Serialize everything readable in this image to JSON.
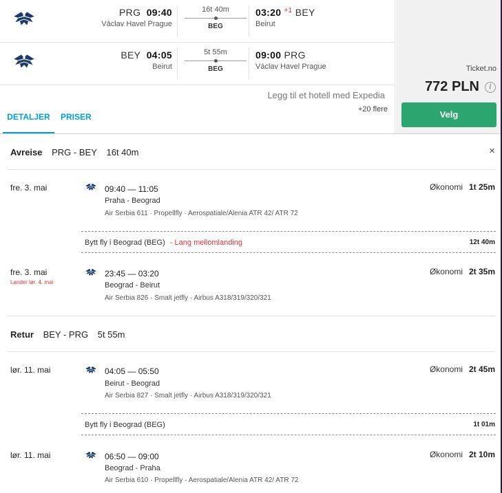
{
  "summary": {
    "outbound": {
      "dep_code": "PRG",
      "dep_time": "09:40",
      "dep_airport": "Václav Havel Prague",
      "duration": "16t 40m",
      "stop": "BEG",
      "arr_time": "03:20",
      "arr_plus": "+1",
      "arr_code": "BEY",
      "arr_airport": "Beirut"
    },
    "return": {
      "dep_code": "BEY",
      "dep_time": "04:05",
      "dep_airport": "Beirut",
      "duration": "5t 55m",
      "stop": "BEG",
      "arr_time": "09:00",
      "arr_code": "PRG",
      "arr_airport": "Václav Havel Prague"
    },
    "hotel_link": "Legg til et hotell med Expedia",
    "tabs": [
      "DETALJER",
      "PRISER"
    ],
    "more_providers": "+20 flere",
    "provider": "Ticket.no",
    "price": "772 PLN",
    "info_icon": "i",
    "select_label": "Velg"
  },
  "details": {
    "close_icon": "×",
    "outbound": {
      "label": "Avreise",
      "route": "PRG - BEY",
      "duration": "16t 40m",
      "segments": [
        {
          "date": "fre. 3. mai",
          "sub": "",
          "times": "09:40 — 11:05",
          "cities": "Praha - Beograd",
          "info": "Air Serbia 611 · Propellfly · Aerospatiale/Alenia ATR 42/ ATR 72",
          "cabin": "Økonomi",
          "duration": "1t 25m"
        },
        {
          "date": "fre. 3. mai",
          "sub": "Lander lør. 4. mai",
          "times": "23:45 — 03:20",
          "cities": "Beograd - Beirut",
          "info": "Air Serbia 826 · Smalt jetfly · Airbus A318/319/320/321",
          "cabin": "Økonomi",
          "duration": "2t 35m"
        }
      ],
      "layover": {
        "text": "Bytt fly i Beograd (BEG)",
        "warning": "- Lang mellomlanding",
        "duration": "12t 40m"
      }
    },
    "return": {
      "label": "Retur",
      "route": "BEY - PRG",
      "duration": "5t 55m",
      "segments": [
        {
          "date": "lør. 11. mai",
          "sub": "",
          "times": "04:05 — 05:50",
          "cities": "Beirut - Beograd",
          "info": "Air Serbia 827 · Smalt jetfly · Airbus A318/319/320/321",
          "cabin": "Økonomi",
          "duration": "2t 45m"
        },
        {
          "date": "lør. 11. mai",
          "sub": "",
          "times": "06:50 — 09:00",
          "cities": "Beograd - Praha",
          "info": "Air Serbia 610 · Propellfly · Aerospatiale/Alenia ATR 42/ ATR 72",
          "cabin": "Økonomi",
          "duration": "2t 10m"
        }
      ],
      "layover": {
        "text": "Bytt fly i Beograd (BEG)",
        "warning": "",
        "duration": "1t 01m"
      }
    }
  },
  "colors": {
    "accent": "#00a0d6",
    "select_button": "#2da56e",
    "warning": "#e0333a",
    "airline_logo": "#1b3a6b"
  },
  "icons": {
    "airline_logo": "air-serbia-eagle-logo",
    "close": "close-icon",
    "info": "info-icon"
  }
}
